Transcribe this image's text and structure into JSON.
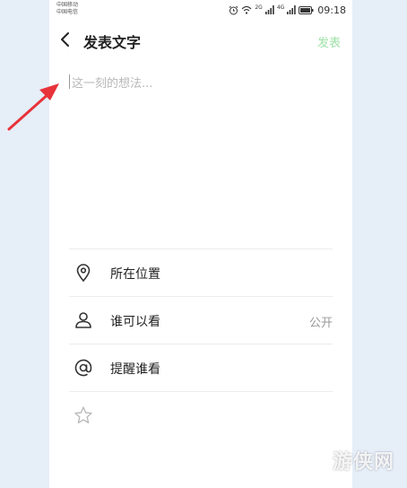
{
  "status_bar": {
    "carrier_1": "中国移动",
    "carrier_2": "中国电信",
    "net_1": "2G",
    "net_2": "4G",
    "time": "09:18"
  },
  "nav": {
    "title": "发表文字",
    "publish_label": "发表",
    "publish_color": "#9ee0a6"
  },
  "compose": {
    "placeholder": "这一刻的想法..."
  },
  "options": [
    {
      "label": "所在位置",
      "value": "",
      "icon": "location-pin-icon"
    },
    {
      "label": "谁可以看",
      "value": "公开",
      "icon": "person-icon"
    },
    {
      "label": "提醒谁看",
      "value": "",
      "icon": "at-sign-icon"
    }
  ],
  "extra_icon": "star-icon",
  "annotation": {
    "arrow_color": "#e8333a"
  },
  "watermark": "游侠网"
}
